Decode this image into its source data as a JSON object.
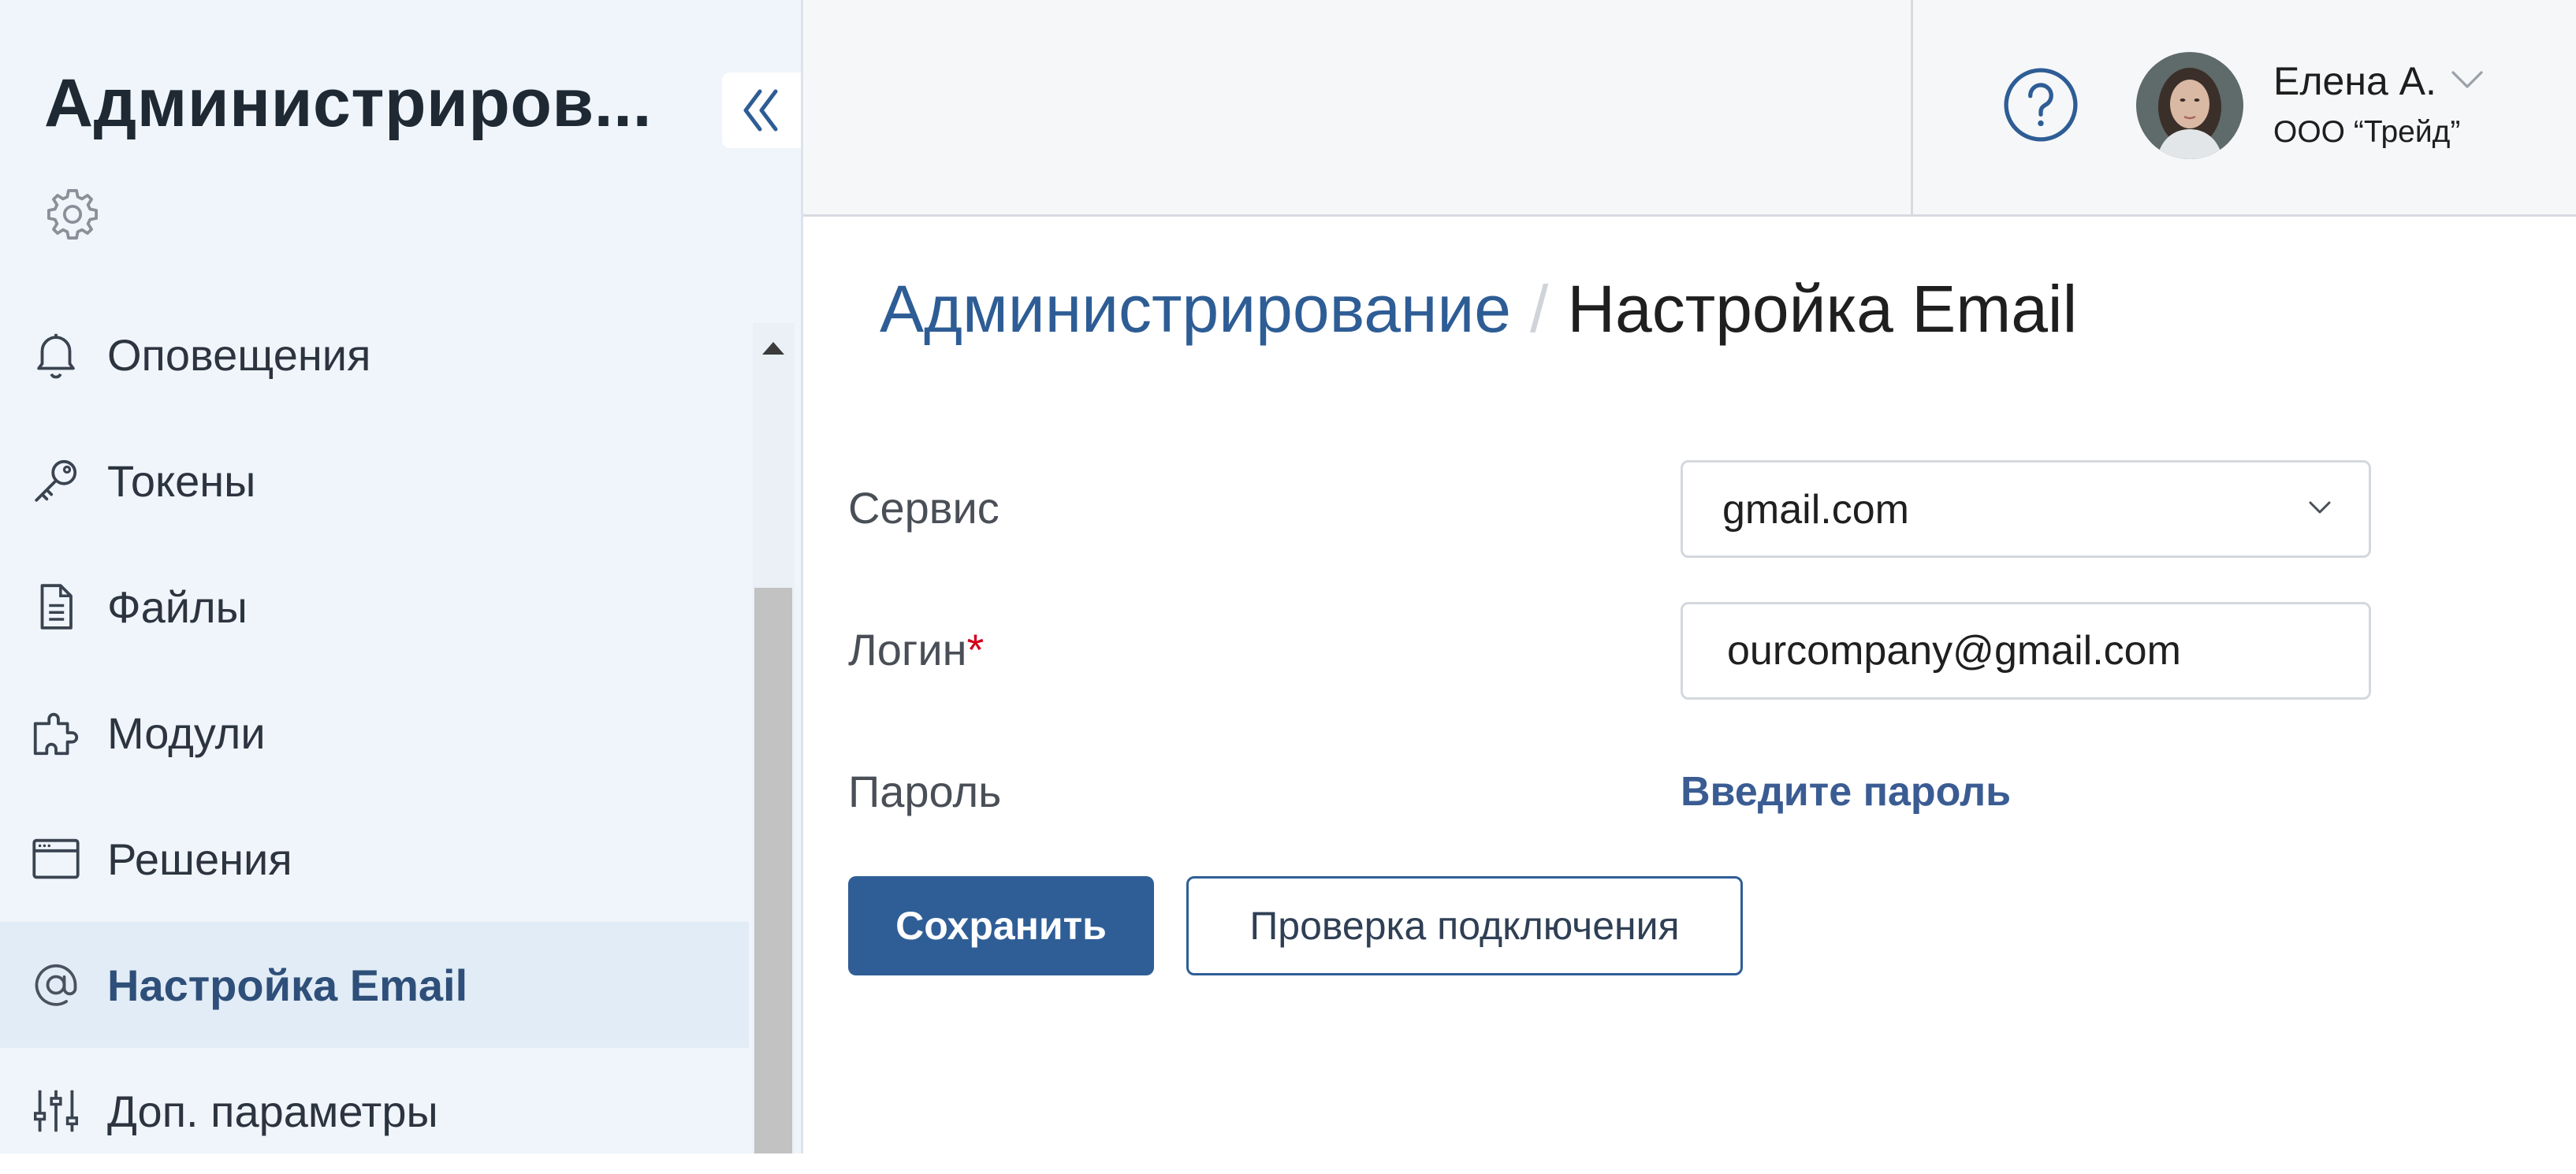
{
  "sidebar": {
    "title": "Администриров...",
    "items": [
      {
        "label": "Оповещения",
        "icon": "bell-icon"
      },
      {
        "label": "Токены",
        "icon": "key-icon"
      },
      {
        "label": "Файлы",
        "icon": "file-icon"
      },
      {
        "label": "Модули",
        "icon": "puzzle-icon"
      },
      {
        "label": "Решения",
        "icon": "window-icon"
      },
      {
        "label": "Настройка Email",
        "icon": "at-icon",
        "active": true
      },
      {
        "label": "Доп. параметры",
        "icon": "sliders-icon"
      }
    ]
  },
  "header": {
    "user_name": "Елена А.",
    "user_org": "ООО “Трейд”"
  },
  "breadcrumb": {
    "parent": "Администрирование",
    "separator": "/",
    "current": "Настройка Email"
  },
  "form": {
    "service_label": "Сервис",
    "service_value": "gmail.com",
    "login_label": "Логин",
    "login_required": "*",
    "login_value": "ourcompany@gmail.com",
    "password_label": "Пароль",
    "password_link": "Введите пароль"
  },
  "actions": {
    "save_label": "Сохранить",
    "check_label": "Проверка подключения"
  },
  "colors": {
    "accent": "#2f5e97",
    "sidebar_bg": "#eff5fa",
    "active_item_bg": "#e2ecf6",
    "required": "#d0021b"
  }
}
